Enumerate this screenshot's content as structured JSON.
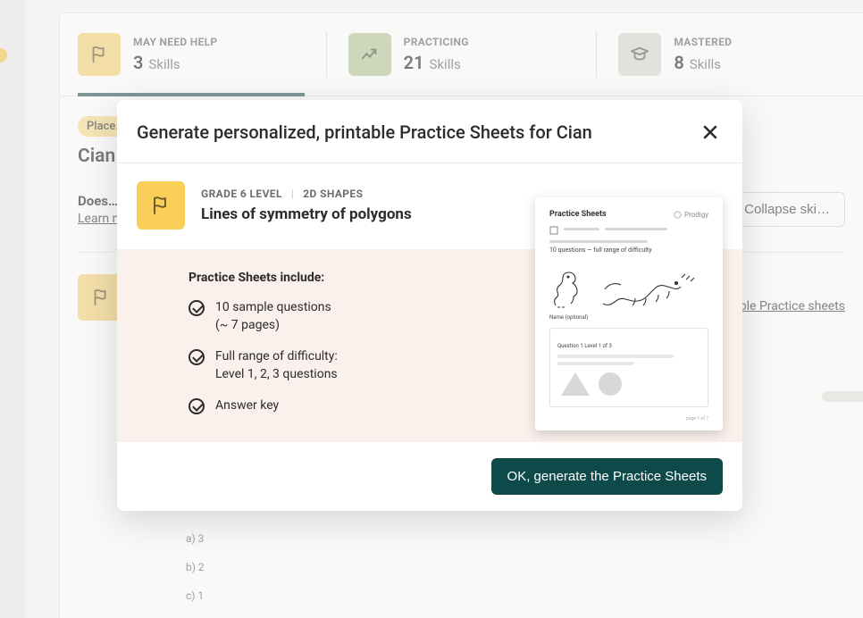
{
  "stats": [
    {
      "label": "MAY NEED HELP",
      "value": "3",
      "unit": "Skills"
    },
    {
      "label": "PRACTICING",
      "value": "21",
      "unit": "Skills"
    },
    {
      "label": "MASTERED",
      "value": "8",
      "unit": "Skills"
    }
  ],
  "placement_badge": "Place…",
  "student_name": "Cian",
  "does_question": "Does…",
  "learn_more": "Learn m…",
  "collapse_label": "Collapse ski…",
  "practice_link": "ble Practice sheets",
  "answers": {
    "a": "a) 3",
    "b": "b) 2",
    "c": "c) 1"
  },
  "modal": {
    "title": "Generate personalized, printable Practice Sheets for Cian",
    "grade": "GRADE 6 LEVEL",
    "topic": "2D SHAPES",
    "skill": "Lines of symmetry of polygons",
    "includes_title": "Practice Sheets include:",
    "features": {
      "f1a": "10 sample questions",
      "f1b": "(~ 7 pages)",
      "f2a": "Full range of difficulty:",
      "f2b": "Level 1, 2, 3 questions",
      "f3": "Answer key"
    },
    "preview": {
      "title": "Practice Sheets",
      "brand": "Prodigy",
      "subtitle": "10 questions — full range of difficulty",
      "name_label": "Name (optional)",
      "q_label": "Question 1   Level 1 of 3",
      "footer_left": "",
      "footer_right": "page 1 of 7"
    },
    "cta": "OK, generate the Practice Sheets"
  }
}
